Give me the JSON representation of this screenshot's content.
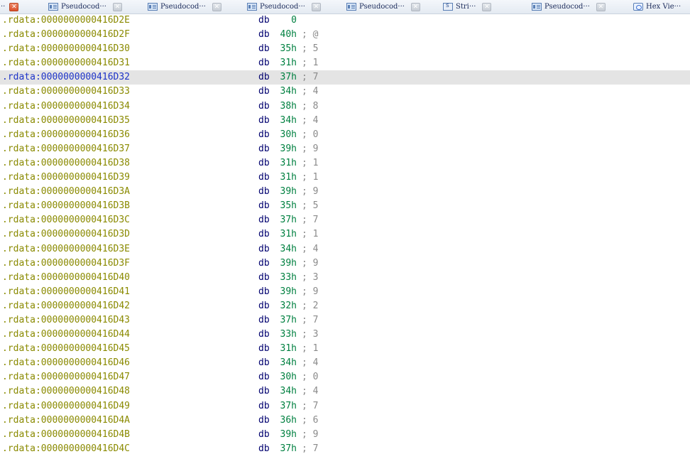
{
  "tabs": [
    {
      "kind": "lead",
      "label": "··",
      "active": true
    },
    {
      "kind": "pseudocode",
      "label": "Pseudocod···"
    },
    {
      "kind": "pseudocode",
      "label": "Pseudocod···"
    },
    {
      "kind": "pseudocode",
      "label": "Pseudocod···"
    },
    {
      "kind": "pseudocode",
      "label": "Pseudocod···"
    },
    {
      "kind": "strings",
      "label": "Stri···"
    },
    {
      "kind": "pseudocode",
      "label": "Pseudocod···"
    },
    {
      "kind": "hex",
      "label": "Hex Vie···"
    }
  ],
  "close_glyph": "✕",
  "selected_row": 4,
  "rows": [
    {
      "addr": ".rdata:0000000000416D2E",
      "mnem": "db",
      "val": "0",
      "cmt": ""
    },
    {
      "addr": ".rdata:0000000000416D2F",
      "mnem": "db",
      "val": "40h",
      "cmt": "; @"
    },
    {
      "addr": ".rdata:0000000000416D30",
      "mnem": "db",
      "val": "35h",
      "cmt": "; 5"
    },
    {
      "addr": ".rdata:0000000000416D31",
      "mnem": "db",
      "val": "31h",
      "cmt": "; 1"
    },
    {
      "addr": ".rdata:0000000000416D32",
      "mnem": "db",
      "val": "37h",
      "cmt": "; 7"
    },
    {
      "addr": ".rdata:0000000000416D33",
      "mnem": "db",
      "val": "34h",
      "cmt": "; 4"
    },
    {
      "addr": ".rdata:0000000000416D34",
      "mnem": "db",
      "val": "38h",
      "cmt": "; 8"
    },
    {
      "addr": ".rdata:0000000000416D35",
      "mnem": "db",
      "val": "34h",
      "cmt": "; 4"
    },
    {
      "addr": ".rdata:0000000000416D36",
      "mnem": "db",
      "val": "30h",
      "cmt": "; 0"
    },
    {
      "addr": ".rdata:0000000000416D37",
      "mnem": "db",
      "val": "39h",
      "cmt": "; 9"
    },
    {
      "addr": ".rdata:0000000000416D38",
      "mnem": "db",
      "val": "31h",
      "cmt": "; 1"
    },
    {
      "addr": ".rdata:0000000000416D39",
      "mnem": "db",
      "val": "31h",
      "cmt": "; 1"
    },
    {
      "addr": ".rdata:0000000000416D3A",
      "mnem": "db",
      "val": "39h",
      "cmt": "; 9"
    },
    {
      "addr": ".rdata:0000000000416D3B",
      "mnem": "db",
      "val": "35h",
      "cmt": "; 5"
    },
    {
      "addr": ".rdata:0000000000416D3C",
      "mnem": "db",
      "val": "37h",
      "cmt": "; 7"
    },
    {
      "addr": ".rdata:0000000000416D3D",
      "mnem": "db",
      "val": "31h",
      "cmt": "; 1"
    },
    {
      "addr": ".rdata:0000000000416D3E",
      "mnem": "db",
      "val": "34h",
      "cmt": "; 4"
    },
    {
      "addr": ".rdata:0000000000416D3F",
      "mnem": "db",
      "val": "39h",
      "cmt": "; 9"
    },
    {
      "addr": ".rdata:0000000000416D40",
      "mnem": "db",
      "val": "33h",
      "cmt": "; 3"
    },
    {
      "addr": ".rdata:0000000000416D41",
      "mnem": "db",
      "val": "39h",
      "cmt": "; 9"
    },
    {
      "addr": ".rdata:0000000000416D42",
      "mnem": "db",
      "val": "32h",
      "cmt": "; 2"
    },
    {
      "addr": ".rdata:0000000000416D43",
      "mnem": "db",
      "val": "37h",
      "cmt": "; 7"
    },
    {
      "addr": ".rdata:0000000000416D44",
      "mnem": "db",
      "val": "33h",
      "cmt": "; 3"
    },
    {
      "addr": ".rdata:0000000000416D45",
      "mnem": "db",
      "val": "31h",
      "cmt": "; 1"
    },
    {
      "addr": ".rdata:0000000000416D46",
      "mnem": "db",
      "val": "34h",
      "cmt": "; 4"
    },
    {
      "addr": ".rdata:0000000000416D47",
      "mnem": "db",
      "val": "30h",
      "cmt": "; 0"
    },
    {
      "addr": ".rdata:0000000000416D48",
      "mnem": "db",
      "val": "34h",
      "cmt": "; 4"
    },
    {
      "addr": ".rdata:0000000000416D49",
      "mnem": "db",
      "val": "37h",
      "cmt": "; 7"
    },
    {
      "addr": ".rdata:0000000000416D4A",
      "mnem": "db",
      "val": "36h",
      "cmt": "; 6"
    },
    {
      "addr": ".rdata:0000000000416D4B",
      "mnem": "db",
      "val": "39h",
      "cmt": "; 9"
    },
    {
      "addr": ".rdata:0000000000416D4C",
      "mnem": "db",
      "val": "37h",
      "cmt": "; 7"
    }
  ]
}
